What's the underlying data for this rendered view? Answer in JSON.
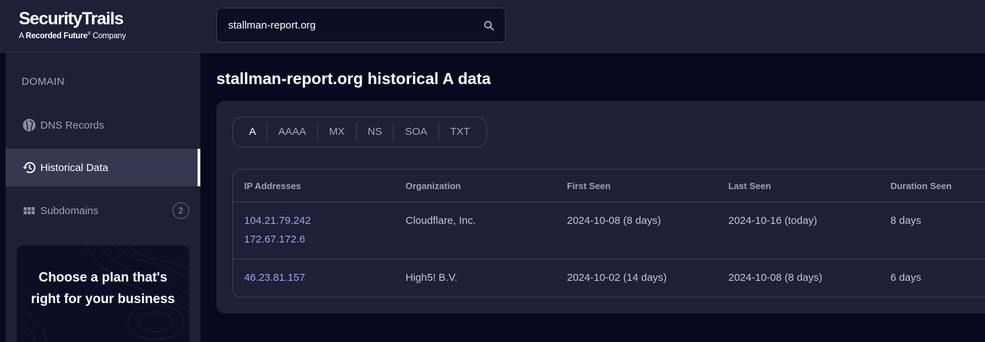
{
  "brand": {
    "name": "SecurityTrails",
    "tagline_prefix": "A ",
    "tagline_brand": "Recorded Future",
    "tagline_suffix": " Company"
  },
  "search": {
    "value": "stallman-report.org"
  },
  "sidebar": {
    "heading": "DOMAIN",
    "items": [
      {
        "label": "DNS Records",
        "icon": "globe-icon"
      },
      {
        "label": "Historical Data",
        "icon": "history-icon",
        "active": true
      },
      {
        "label": "Subdomains",
        "icon": "grid-icon",
        "count": "2"
      }
    ],
    "promo": "Choose a plan that's right for your business"
  },
  "main": {
    "title": "stallman-report.org historical A data",
    "tabs": [
      "A",
      "AAAA",
      "MX",
      "NS",
      "SOA",
      "TXT"
    ],
    "table": {
      "columns": [
        "IP Addresses",
        "Organization",
        "First Seen",
        "Last Seen",
        "Duration Seen"
      ],
      "rows": [
        {
          "ips": [
            "104.21.79.242",
            "172.67.172.6"
          ],
          "organization": "Cloudflare, Inc.",
          "first_seen": "2024-10-08 (8 days)",
          "last_seen": "2024-10-16 (today)",
          "duration": "8 days"
        },
        {
          "ips": [
            "46.23.81.157"
          ],
          "organization": "High5! B.V.",
          "first_seen": "2024-10-02 (14 days)",
          "last_seen": "2024-10-08 (8 days)",
          "duration": "6 days"
        }
      ]
    }
  },
  "colors": {
    "background": "#070a1e",
    "panel": "#1d2036",
    "link": "#9ea6f0",
    "active_item": "#343851"
  }
}
